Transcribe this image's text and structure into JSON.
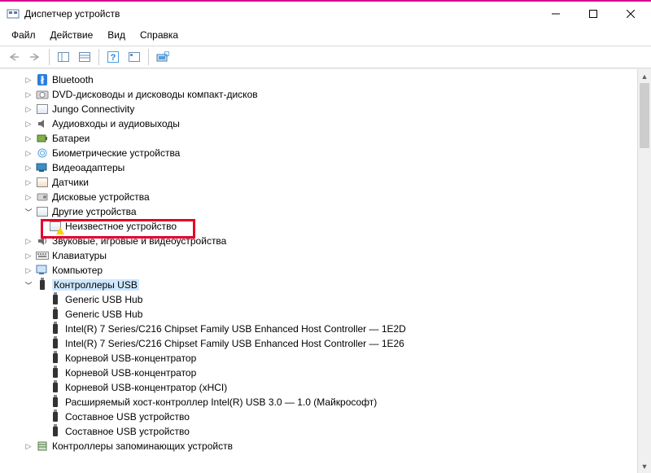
{
  "titlebar": {
    "title": "Диспетчер устройств"
  },
  "menu": {
    "file": "Файл",
    "action": "Действие",
    "view": "Вид",
    "help": "Справка"
  },
  "tree": {
    "n0": "Bluetooth",
    "n1": "DVD-дисководы и дисководы компакт-дисков",
    "n2": "Jungo Connectivity",
    "n3": "Аудиовходы и аудиовыходы",
    "n4": "Батареи",
    "n5": "Биометрические устройства",
    "n6": "Видеоадаптеры",
    "n7": "Датчики",
    "n8": "Дисковые устройства",
    "n9": "Другие устройства",
    "n9a": "Неизвестное устройство",
    "n10": "Звуковые, игровые и видеоустройства",
    "n11": "Клавиатуры",
    "n12": "Компьютер",
    "n13": "Контроллеры USB",
    "c0": "Generic USB Hub",
    "c1": "Generic USB Hub",
    "c2": "Intel(R) 7 Series/C216 Chipset Family USB Enhanced Host Controller — 1E2D",
    "c3": "Intel(R) 7 Series/C216 Chipset Family USB Enhanced Host Controller — 1E26",
    "c4": "Корневой USB-концентратор",
    "c5": "Корневой USB-концентратор",
    "c6": "Корневой USB-концентратор (xHCI)",
    "c7": "Расширяемый хост-контроллер Intel(R) USB 3.0 — 1.0 (Майкрософт)",
    "c8": "Составное USB устройство",
    "c9": "Составное USB устройство",
    "n14": "Контроллеры запоминающих устройств"
  }
}
